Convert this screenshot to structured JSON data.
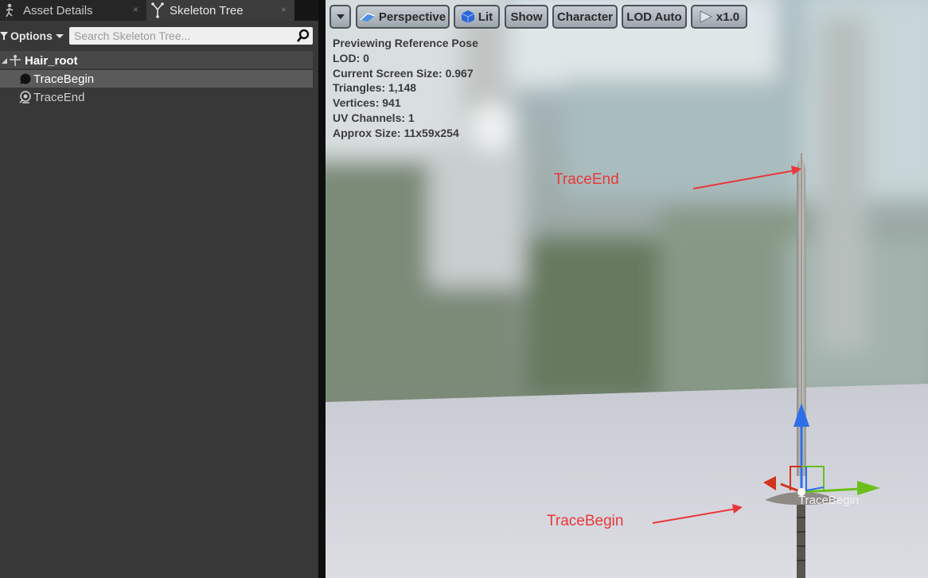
{
  "tabs": [
    {
      "label": "Asset Details",
      "icon": "asset-details-icon"
    },
    {
      "label": "Skeleton Tree",
      "icon": "skeleton-tree-icon"
    }
  ],
  "tab_close_glyph": "×",
  "toolbar": {
    "options_label": "Options",
    "search_placeholder": "Search Skeleton Tree..."
  },
  "tree": [
    {
      "label": "Hair_root",
      "icon": "bone-root-icon"
    },
    {
      "label": "TraceBegin",
      "icon": "socket-icon",
      "selected": true
    },
    {
      "label": "TraceEnd",
      "icon": "socket-icon"
    }
  ],
  "viewport": {
    "toolbar": [
      {
        "label": "",
        "icon": "chevron-down-icon"
      },
      {
        "label": "Perspective",
        "icon": "perspective-icon"
      },
      {
        "label": "Lit",
        "icon": "lit-cube-icon"
      },
      {
        "label": "Show"
      },
      {
        "label": "Character"
      },
      {
        "label": "LOD Auto"
      },
      {
        "label": "x1.0",
        "icon": "play-speed-icon"
      }
    ],
    "stats": [
      "Previewing Reference Pose",
      "LOD: 0",
      "Current Screen Size: 0.967",
      "Triangles: 1,148",
      "Vertices: 941",
      "UV Channels: 1",
      "Approx Size: 11x59x254"
    ],
    "annotations": {
      "trace_end": "TraceEnd",
      "trace_begin": "TraceBegin"
    },
    "socket_label": "TraceBegin",
    "colors": {
      "annotation": "#e8383a",
      "gizmo_x": "#d0341c",
      "gizmo_y": "#6cbf1a",
      "gizmo_z": "#2d6fe8"
    }
  }
}
